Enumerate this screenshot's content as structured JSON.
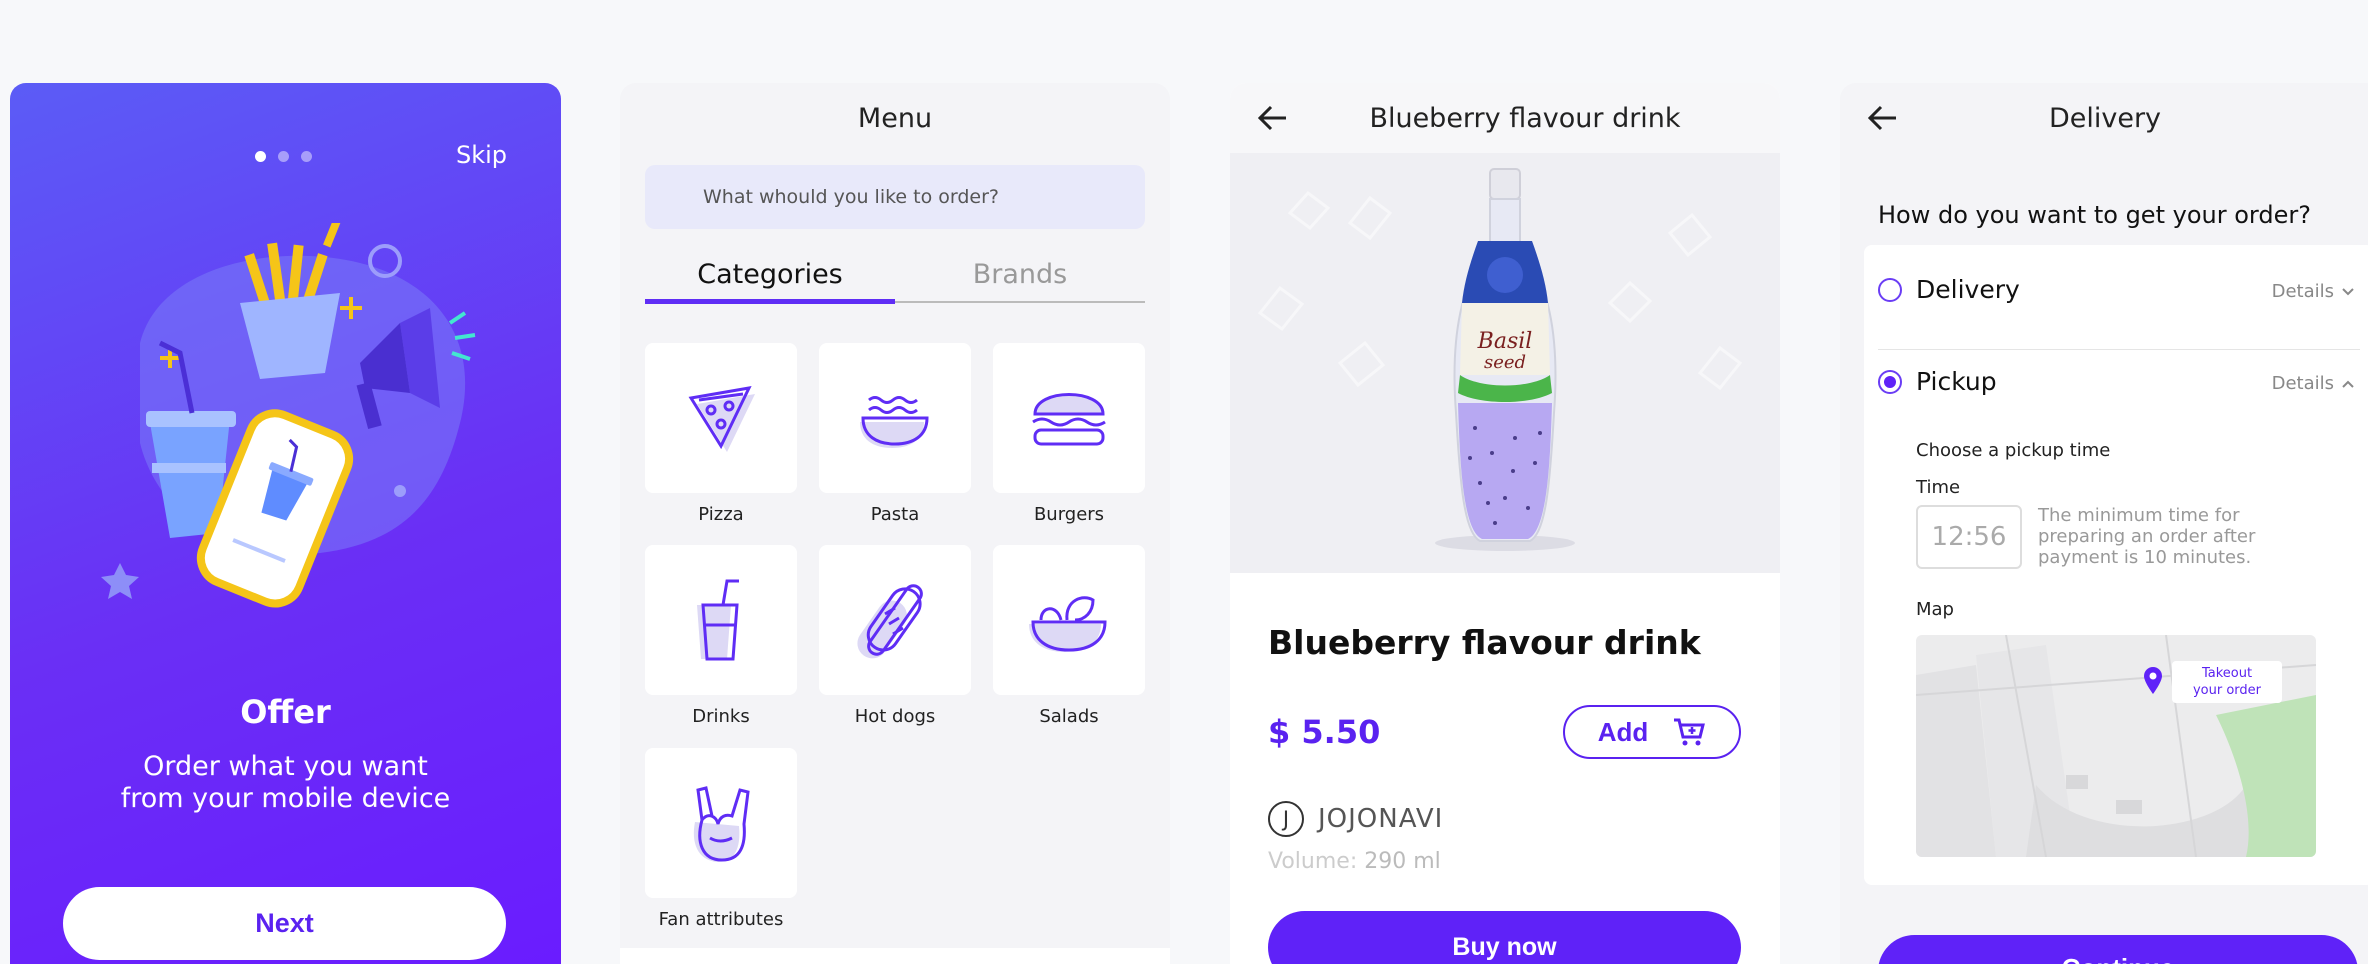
{
  "onboarding": {
    "skip_label": "Skip",
    "title": "Offer",
    "subtitle": "Order what you want\nfrom your mobile device",
    "next_label": "Next",
    "page_count": 3,
    "active_page": 1
  },
  "menu": {
    "title": "Menu",
    "search_placeholder": "What whould you like to order?",
    "tabs": [
      {
        "label": "Categories",
        "active": true
      },
      {
        "label": "Brands",
        "active": false
      }
    ],
    "categories": [
      {
        "label": "Pizza",
        "icon": "pizza-icon"
      },
      {
        "label": "Pasta",
        "icon": "pasta-icon"
      },
      {
        "label": "Burgers",
        "icon": "burger-icon"
      },
      {
        "label": "Drinks",
        "icon": "drink-icon"
      },
      {
        "label": "Hot dogs",
        "icon": "hotdog-icon"
      },
      {
        "label": "Salads",
        "icon": "salad-icon"
      },
      {
        "label": "Fan attributes",
        "icon": "fan-hand-icon"
      }
    ]
  },
  "product": {
    "header_title": "Blueberry flavour drink",
    "name": "Blueberry flavour drink",
    "price": "$ 5.50",
    "add_label": "Add",
    "brand_initial": "J",
    "brand": "JOJONAVI",
    "volume_label": "Volume:",
    "volume_value": "290 ml",
    "buy_label": "Buy now"
  },
  "delivery": {
    "title": "Delivery",
    "question": "How do you want to get your order?",
    "options": [
      {
        "label": "Delivery",
        "details": "Details",
        "selected": false
      },
      {
        "label": "Pickup",
        "details": "Details",
        "selected": true
      }
    ],
    "pickup_title": "Choose a pickup time",
    "time_label": "Time",
    "time_value": "12:56",
    "time_hint": "The minimum time for preparing an order after payment is 10 minutes.",
    "map_label": "Map",
    "map_tag_line1": "Takeout",
    "map_tag_line2": "your order",
    "continue_label": "Continue"
  },
  "colors": {
    "accent": "#5f22f8",
    "onboarding_bg": "#6a2ff5",
    "gold": "#f5c518"
  }
}
